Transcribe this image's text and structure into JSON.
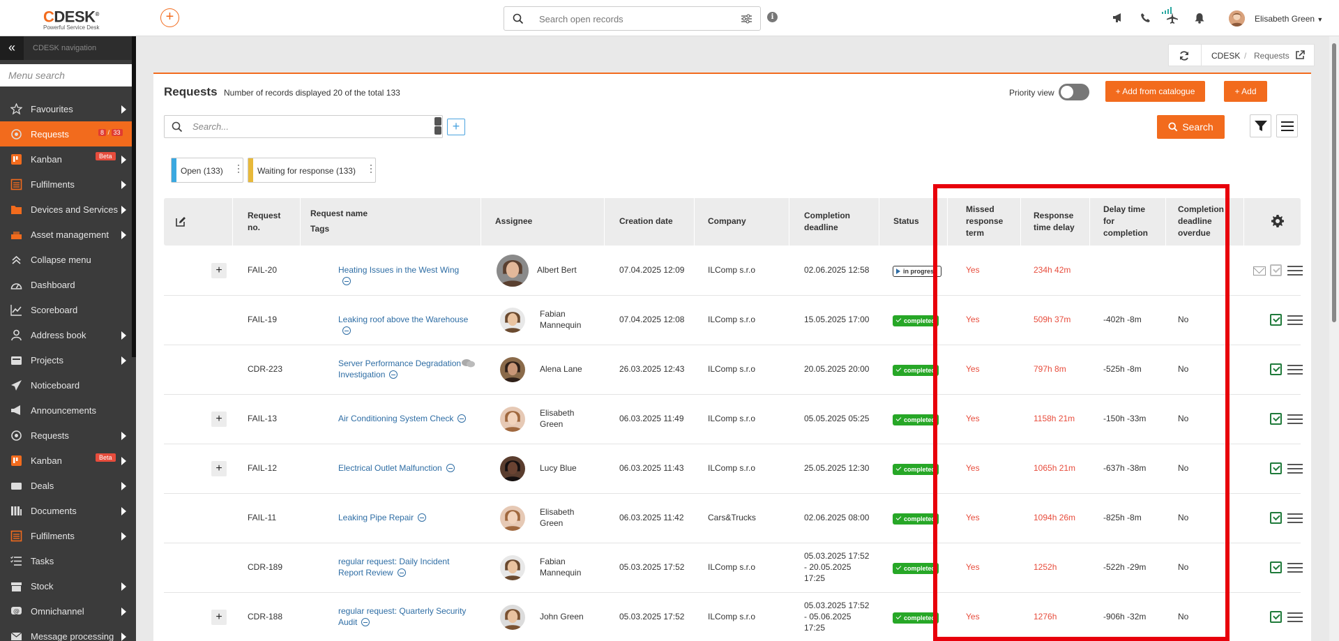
{
  "app": {
    "logo_text": "CDESK",
    "logo_tagline": "Powerful Service Desk",
    "search_placeholder": "Search open records",
    "user_name": "Elisabeth Green"
  },
  "sidebar": {
    "title": "CDESK navigation",
    "search_placeholder": "Menu search",
    "items": [
      {
        "label": "Favourites",
        "icon": "star-icon",
        "arrow": true
      },
      {
        "label": "Requests",
        "icon": "requests-icon",
        "active": true,
        "count_a": "8",
        "count_b": "33"
      },
      {
        "label": "Kanban",
        "icon": "kanban-icon",
        "arrow": true,
        "beta": "Beta"
      },
      {
        "label": "Fulfilments",
        "icon": "fulfilments-icon",
        "arrow": true
      },
      {
        "label": "Devices and Services",
        "icon": "folder-icon",
        "arrow": true
      },
      {
        "label": "Asset management",
        "icon": "asset-icon",
        "arrow": true
      },
      {
        "label": "Collapse menu",
        "icon": "collapse-icon"
      },
      {
        "label": "Dashboard",
        "icon": "dashboard-icon"
      },
      {
        "label": "Scoreboard",
        "icon": "chart-icon"
      },
      {
        "label": "Address book",
        "icon": "person-icon",
        "arrow": true
      },
      {
        "label": "Projects",
        "icon": "projects-icon",
        "arrow": true
      },
      {
        "label": "Noticeboard",
        "icon": "paper-plane-icon"
      },
      {
        "label": "Announcements",
        "icon": "megaphone-icon"
      },
      {
        "label": "Requests",
        "icon": "requests-icon",
        "arrow": true
      },
      {
        "label": "Kanban",
        "icon": "kanban-icon",
        "arrow": true,
        "beta": "Beta"
      },
      {
        "label": "Deals",
        "icon": "deals-icon",
        "arrow": true
      },
      {
        "label": "Documents",
        "icon": "documents-icon",
        "arrow": true
      },
      {
        "label": "Fulfilments",
        "icon": "fulfilments-icon",
        "arrow": true
      },
      {
        "label": "Tasks",
        "icon": "tasks-icon"
      },
      {
        "label": "Stock",
        "icon": "stock-icon",
        "arrow": true
      },
      {
        "label": "Omnichannel",
        "icon": "omnichannel-icon",
        "arrow": true
      },
      {
        "label": "Message processing",
        "icon": "message-icon",
        "arrow": true
      }
    ]
  },
  "breadcrumb": {
    "root": "CDESK",
    "separator": "/",
    "current": "Requests"
  },
  "main": {
    "title": "Requests",
    "count_text": "Number of records displayed 20 of the total 133",
    "priority_label": "Priority view",
    "add_catalogue_label": "+ Add from catalogue",
    "add_label": "+ Add",
    "search_placeholder": "Search...",
    "search_button": "Search",
    "tags": [
      {
        "label": "Open (133)",
        "color": "#3aa8e0"
      },
      {
        "label": "Waiting for response (133)",
        "color": "#e8b93a"
      }
    ]
  },
  "table": {
    "headers": {
      "req_no": "Request no.",
      "req_name": "Request name",
      "tags": "Tags",
      "assignee": "Assignee",
      "creation": "Creation date",
      "company": "Company",
      "completion": "Completion deadline",
      "status": "Status",
      "missed": "Missed response term",
      "resp_delay": "Response time delay",
      "delay_completion": "Delay time for completion",
      "overdue": "Completion deadline overdue"
    },
    "rows": [
      {
        "plus": true,
        "no": "FAIL-20",
        "name": "Heating Issues in the West Wing",
        "assignee": "Albert Bert",
        "created": "07.04.2025 12:09",
        "company": "ILComp s.r.o",
        "deadline": "02.06.2025 12:58",
        "status": "in progress",
        "missed": "Yes",
        "resp_delay": "234h 42m",
        "delay": "",
        "overdue": ""
      },
      {
        "plus": false,
        "no": "FAIL-19",
        "name": "Leaking roof above the Warehouse",
        "assignee": "Fabian Mannequin",
        "created": "07.04.2025 12:08",
        "company": "ILComp s.r.o",
        "deadline": "15.05.2025 17:00",
        "status": "completed",
        "missed": "Yes",
        "resp_delay": "509h 37m",
        "delay": "-402h -8m",
        "overdue": "No"
      },
      {
        "plus": false,
        "no": "CDR-223",
        "name": "Server Performance Degradation Investigation",
        "assignee": "Alena Lane",
        "created": "26.03.2025 12:43",
        "company": "ILComp s.r.o",
        "deadline": "20.05.2025 20:00",
        "status": "completed",
        "missed": "Yes",
        "resp_delay": "797h 8m",
        "delay": "-525h -8m",
        "overdue": "No"
      },
      {
        "plus": true,
        "no": "FAIL-13",
        "name": "Air Conditioning System Check",
        "assignee": "Elisabeth Green",
        "created": "06.03.2025 11:49",
        "company": "ILComp s.r.o",
        "deadline": "05.05.2025 05:25",
        "status": "completed",
        "missed": "Yes",
        "resp_delay": "1158h 21m",
        "delay": "-150h -33m",
        "overdue": "No"
      },
      {
        "plus": true,
        "no": "FAIL-12",
        "name": "Electrical Outlet Malfunction",
        "assignee": "Lucy Blue",
        "created": "06.03.2025 11:43",
        "company": "ILComp s.r.o",
        "deadline": "25.05.2025 12:30",
        "status": "completed",
        "missed": "Yes",
        "resp_delay": "1065h 21m",
        "delay": "-637h -38m",
        "overdue": "No"
      },
      {
        "plus": false,
        "no": "FAIL-11",
        "name": "Leaking Pipe Repair",
        "assignee": "Elisabeth Green",
        "created": "06.03.2025 11:42",
        "company": "Cars&Trucks",
        "deadline": "02.06.2025 08:00",
        "status": "completed",
        "missed": "Yes",
        "resp_delay": "1094h 26m",
        "delay": "-825h -8m",
        "overdue": "No"
      },
      {
        "plus": false,
        "no": "CDR-189",
        "name": "regular request: Daily Incident Report Review",
        "assignee": "Fabian Mannequin",
        "created": "05.03.2025 17:52",
        "company": "ILComp s.r.o",
        "deadline": "05.03.2025 17:52 - 20.05.2025 17:25",
        "status": "completed",
        "missed": "Yes",
        "resp_delay": "1252h",
        "delay": "-522h -29m",
        "overdue": "No"
      },
      {
        "plus": true,
        "no": "CDR-188",
        "name": "regular request: Quarterly Security Audit",
        "assignee": "John Green",
        "created": "05.03.2025 17:52",
        "company": "ILComp s.r.o",
        "deadline": "05.03.2025 17:52 - 05.06.2025 17:25",
        "status": "completed",
        "missed": "Yes",
        "resp_delay": "1276h",
        "delay": "-906h -32m",
        "overdue": "No"
      }
    ]
  },
  "colors": {
    "accent": "#f26b1d",
    "highlight": "#e8000b",
    "link": "#2e6da4",
    "danger": "#e74c3c",
    "success": "#27a727"
  }
}
